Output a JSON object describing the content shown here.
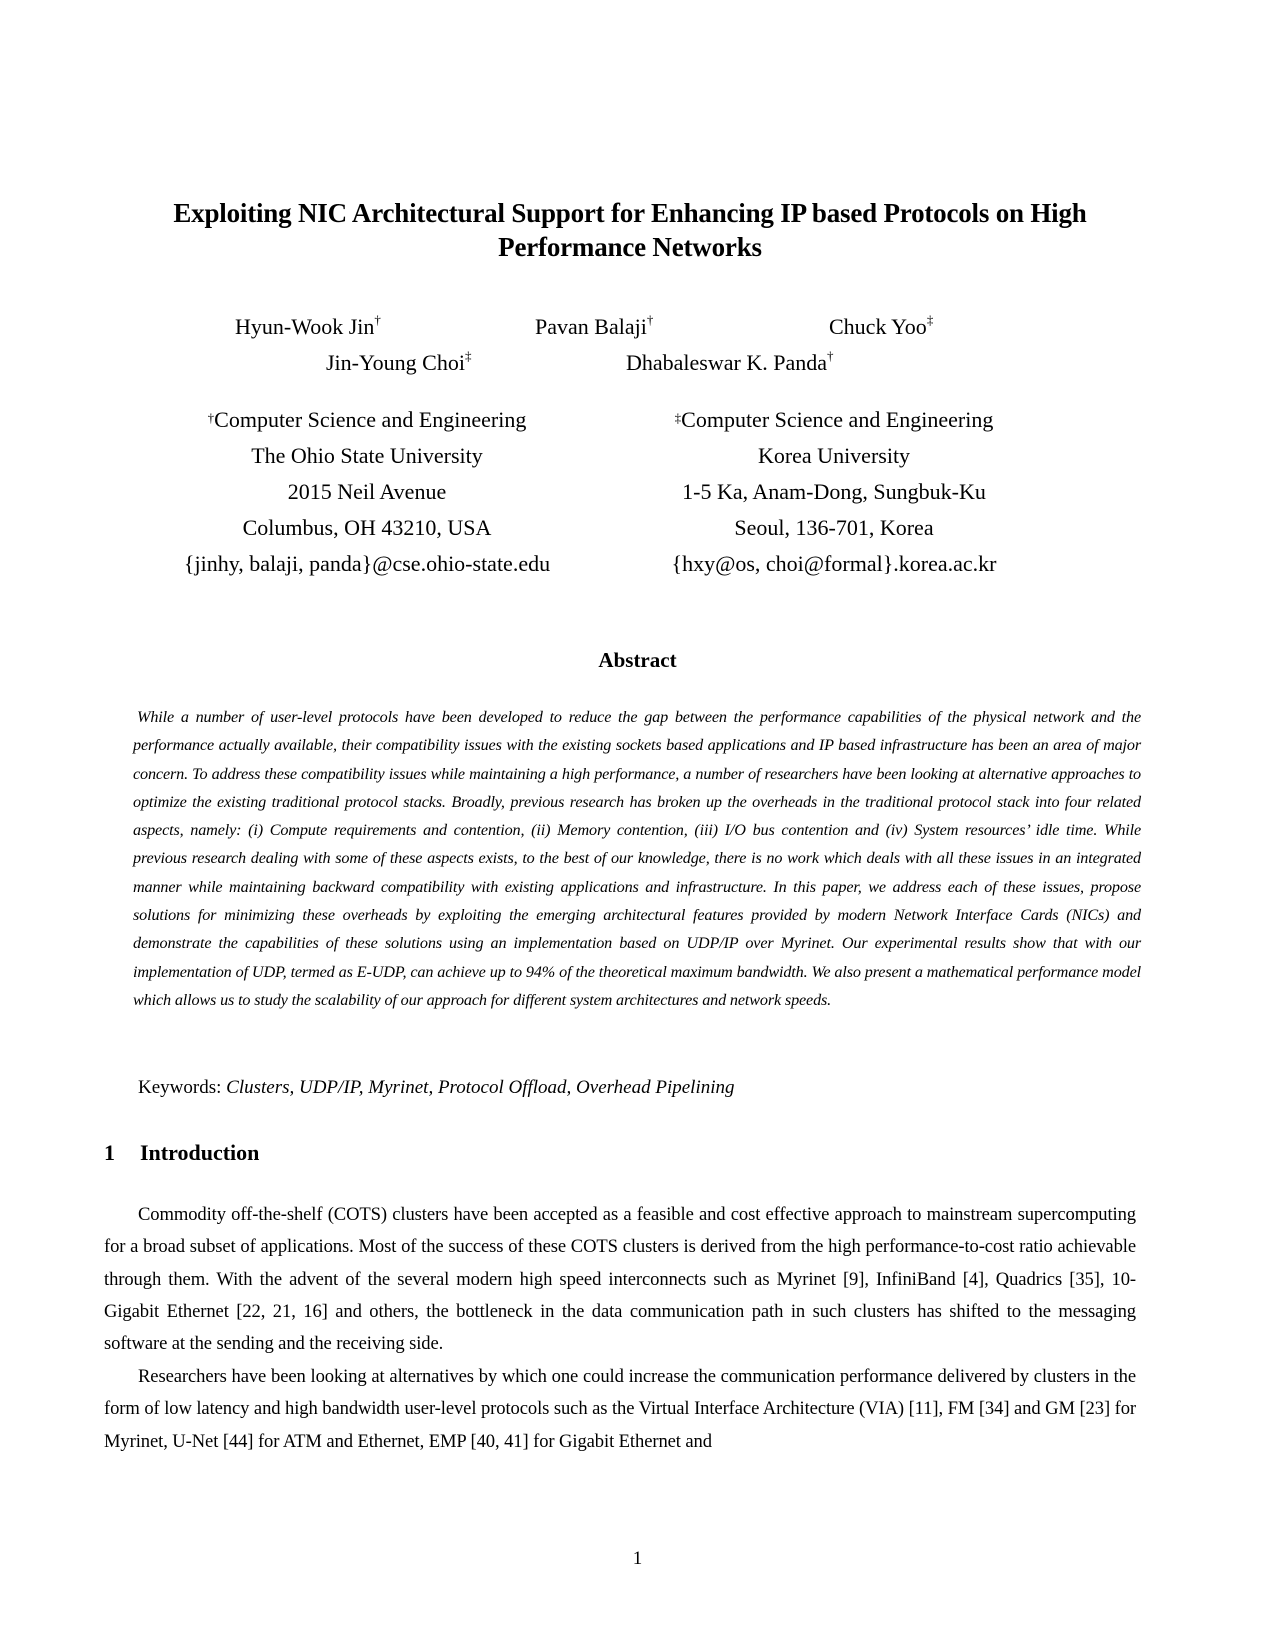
{
  "paper": {
    "title_line1": "Exploiting NIC Architectural Support for Enhancing IP based Protocols on High",
    "title_line2": "Performance Networks",
    "authors": [
      {
        "name": "Hyun-Wook Jin",
        "mark": "†"
      },
      {
        "name": "Pavan Balaji",
        "mark": "†"
      },
      {
        "name": "Chuck Yoo",
        "mark": "‡"
      },
      {
        "name": "Jin-Young Choi",
        "mark": "‡"
      },
      {
        "name": "Dhabaleswar K. Panda",
        "mark": "†"
      }
    ],
    "affiliations": [
      {
        "mark": "†",
        "department": "Computer Science and Engineering",
        "institution": "The Ohio State University",
        "street": "2015 Neil Avenue",
        "city": "Columbus, OH 43210, USA",
        "email": "{jinhy, balaji, panda}@cse.ohio-state.edu"
      },
      {
        "mark": "‡",
        "department": "Computer Science and Engineering",
        "institution": "Korea University",
        "street": "1-5 Ka, Anam-Dong, Sungbuk-Ku",
        "city": "Seoul, 136-701, Korea",
        "email": "{hxy@os, choi@formal}.korea.ac.kr"
      }
    ],
    "abstract_heading": "Abstract",
    "abstract_text": "While a number of user-level protocols have been developed to reduce the gap between the performance capabilities of the physical network and the performance actually available, their compatibility issues with the existing sockets based applications and IP based infrastructure has been an area of major concern. To address these compatibility issues while maintaining a high performance, a number of researchers have been looking at alternative approaches to optimize the existing traditional protocol stacks. Broadly, previous research has broken up the overheads in the traditional protocol stack into four related aspects, namely: (i) Compute requirements and contention, (ii) Memory contention, (iii) I/O bus contention and (iv) System resources’ idle time. While previous research dealing with some of these aspects exists, to the best of our knowledge, there is no work which deals with all these issues in an integrated manner while maintaining backward compatibility with existing applications and infrastructure. In this paper, we address each of these issues, propose solutions for minimizing these overheads by exploiting the emerging architectural features provided by modern Network Interface Cards (NICs) and demonstrate the capabilities of these solutions using an implementation based on UDP/IP over Myrinet. Our experimental results show that with our implementation of UDP, termed as E-UDP, can achieve up to 94% of the theoretical maximum bandwidth. We also present a mathematical performance model which allows us to study the scalability of our approach for different system architectures and network speeds.",
    "keywords_label": "Keywords:",
    "keywords": "Clusters, UDP/IP, Myrinet, Protocol Offload, Overhead Pipelining",
    "section": {
      "number": "1",
      "title": "Introduction",
      "paragraphs": [
        "Commodity off-the-shelf (COTS) clusters have been accepted as a feasible and cost effective approach to mainstream supercomputing for a broad subset of applications. Most of the success of these COTS clusters is derived from the high performance-to-cost ratio achievable through them. With the advent of the several modern high speed interconnects such as Myrinet [9], InfiniBand [4], Quadrics [35], 10-Gigabit Ethernet [22, 21, 16] and others, the bottleneck in the data communi­cation path in such clusters has shifted to the messaging software at the sending and the receiving side.",
        "Researchers have been looking at alternatives by which one could increase the communication performance delivered by clusters in the form of low latency and high bandwidth user-level protocols such as the Virtual Interface Architecture (VIA) [11], FM [34] and GM [23] for Myrinet, U-Net [44] for ATM and Ethernet, EMP [40, 41] for Gigabit Ethernet and"
      ]
    },
    "page_number": "1"
  }
}
